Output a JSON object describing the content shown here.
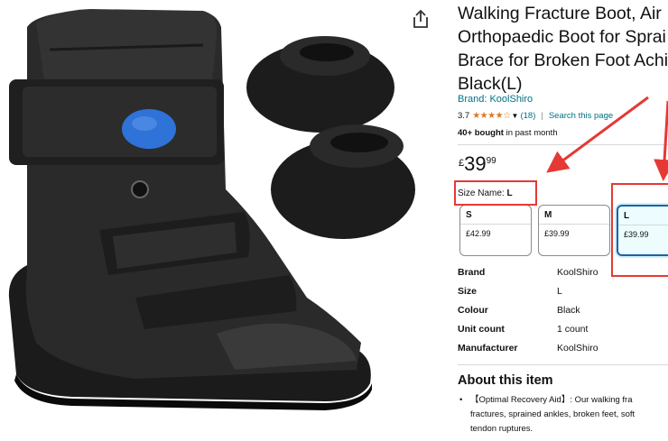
{
  "title_lines": [
    "Walking Fracture Boot, Air",
    "Orthopaedic Boot for Sprai",
    "Brace for Broken Foot Achil",
    "Black(L)"
  ],
  "brand_link": "Brand: KoolShiro",
  "rating": {
    "value": "3.7",
    "stars": "★★★★☆",
    "count": "(18)",
    "search_link": "Search this page"
  },
  "bought": {
    "bold": "40+ bought",
    "rest": " in past month"
  },
  "price": {
    "symbol": "£",
    "whole": "39",
    "fraction": "99"
  },
  "size_name": {
    "label": "Size Name:",
    "value": "L"
  },
  "size_options": [
    {
      "label": "S",
      "price": "£42.99",
      "selected": false
    },
    {
      "label": "M",
      "price": "£39.99",
      "selected": false
    },
    {
      "label": "L",
      "price": "£39.99",
      "selected": true
    }
  ],
  "specs": [
    {
      "key": "Brand",
      "value": "KoolShiro"
    },
    {
      "key": "Size",
      "value": "L"
    },
    {
      "key": "Colour",
      "value": "Black"
    },
    {
      "key": "Unit count",
      "value": "1 count"
    },
    {
      "key": "Manufacturer",
      "value": "KoolShiro"
    }
  ],
  "about_heading": "About this item",
  "about_bullet_lines": [
    "【Optimal Recovery Aid】: Our walking fra",
    "fractures, sprained ankles, broken feet, soft",
    "tendon ruptures."
  ],
  "icons": {
    "share": "share-icon",
    "chevron": "chevron-down-icon"
  },
  "colors": {
    "link": "#007185",
    "star": "#de7921",
    "annotation": "#e53935",
    "selected_border": "#2162a1"
  }
}
